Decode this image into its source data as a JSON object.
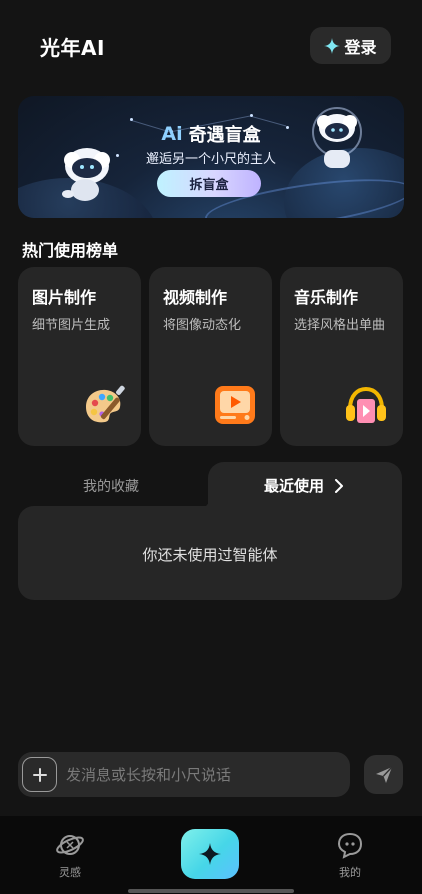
{
  "header": {
    "title": "光年AI",
    "login_label": "登录"
  },
  "banner": {
    "ai_mark": "Ai",
    "title": "奇遇盲盒",
    "subtitle": "邂逅另一个小尺的主人",
    "cta": "拆盲盒"
  },
  "section": {
    "title": "热门使用榜单"
  },
  "cards": [
    {
      "title": "图片制作",
      "desc": "细节图片生成",
      "icon": "palette-icon"
    },
    {
      "title": "视频制作",
      "desc": "将图像动态化",
      "icon": "video-player-icon"
    },
    {
      "title": "音乐制作",
      "desc": "选择风格出单曲",
      "icon": "headphones-music-icon"
    }
  ],
  "tabs": {
    "favorites": "我的收藏",
    "recent": "最近使用"
  },
  "panel": {
    "empty_text": "你还未使用过智能体"
  },
  "input": {
    "placeholder": "发消息或长按和小尺说话",
    "value": ""
  },
  "nav": {
    "left": "灵感",
    "right": "我的"
  },
  "colors": {
    "background": "#141414",
    "card": "#262626",
    "accent": "#46d6e8"
  }
}
